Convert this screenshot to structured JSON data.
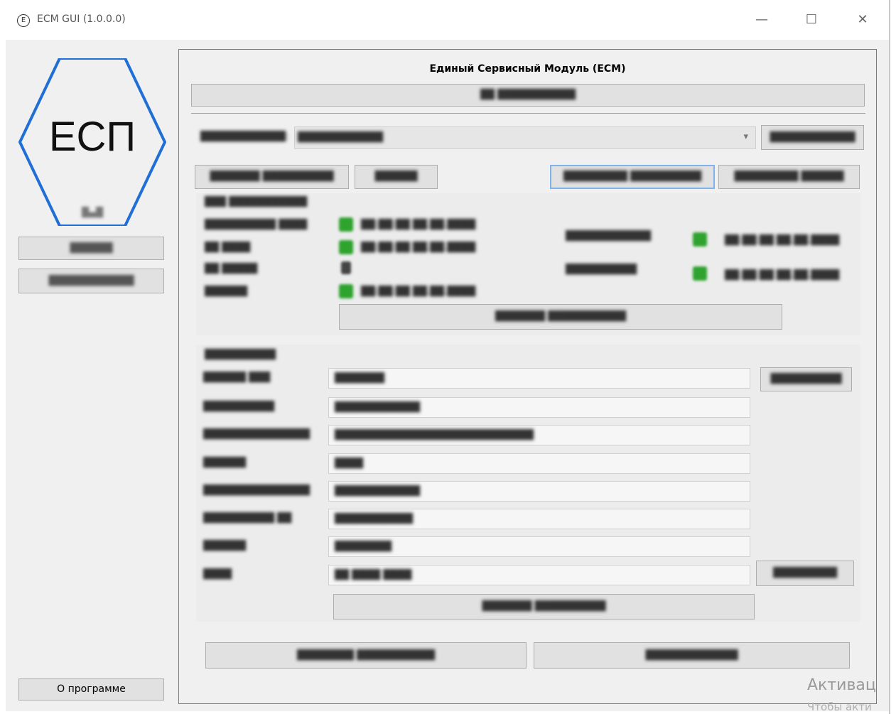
{
  "window": {
    "icon_letter": "E",
    "title": "ECM GUI (1.0.0.0)",
    "minimize_glyph": "—",
    "maximize_glyph": "☐",
    "close_glyph": "✕"
  },
  "logo": {
    "text": "ЕСП",
    "color": "#1f6fd6"
  },
  "sidebar": {
    "user": "█▄█",
    "buttons": [
      "██████",
      "████████████"
    ],
    "about_button": "О программе"
  },
  "main": {
    "title": "Единый Сервисный Модуль (ЕСМ)",
    "top_button": "██ ███████████",
    "identifier_label": "████████████:",
    "identifier_value": "████████████",
    "refresh_list_button": "████████████",
    "action_buttons": [
      "███████ ██████████",
      "██████",
      "█████████ ██████████",
      "█████████ ██████"
    ],
    "modules_title": "███ ███████████",
    "modules": [
      {
        "name": "██████████ ████",
        "status": "green",
        "time": "██:██:██ ██.██.████"
      },
      {
        "name": "██ ████",
        "status": "green",
        "time": "██:██:██ ██.██.████"
      },
      {
        "name": "██ █████",
        "status": "gray",
        "time": ""
      },
      {
        "name": "██████",
        "status": "green",
        "time": "██:██:██ ██.██.████"
      }
    ],
    "right_modules": [
      {
        "name": "████████████",
        "status": "green",
        "time": "██:██:██ ██.██.████"
      },
      {
        "name": "██████████",
        "status": "green",
        "time": "██:██:██ ██.██.████"
      }
    ],
    "refresh_modules_button": "███████ ███████████",
    "info_title": "██████████",
    "info_rows": [
      {
        "label": "██████ ███",
        "value": "███████"
      },
      {
        "label": "██████████",
        "value": "████████████"
      },
      {
        "label": "███████████████",
        "value": "████████████████████████████"
      },
      {
        "label": "██████",
        "value": "████"
      },
      {
        "label": "███████████████",
        "value": "████████████"
      },
      {
        "label": "██████████ ██",
        "value": "███████████"
      },
      {
        "label": "██████",
        "value": "████████"
      },
      {
        "label": "████",
        "value": "██ ████ ████"
      }
    ],
    "info_side_buttons": [
      "██████████",
      "█████████"
    ],
    "update_info_button": "███████ ██████████",
    "bottom_buttons": [
      "████████ ███████████",
      "█████████████"
    ]
  },
  "watermark": {
    "line1": "Активац",
    "line2": "Чтобы акти"
  }
}
